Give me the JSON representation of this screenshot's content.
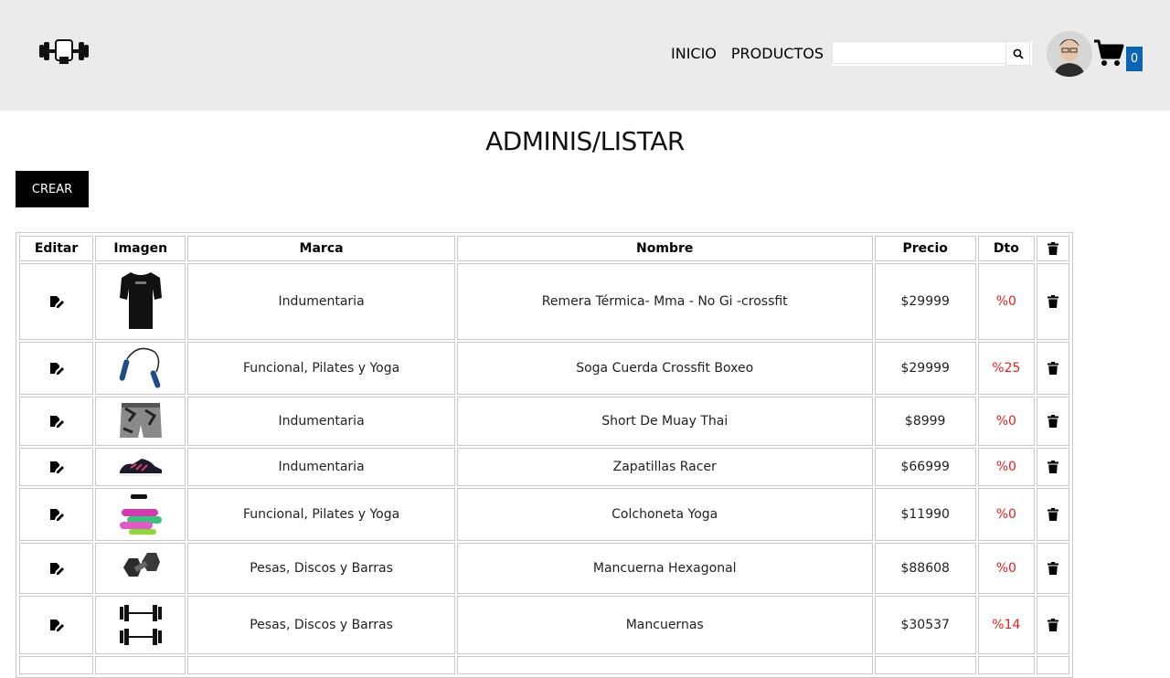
{
  "header": {
    "nav": {
      "inicio": "INICIO",
      "productos": "PRODUCTOS"
    },
    "search": {
      "placeholder": "",
      "value": ""
    },
    "cart_count": "0"
  },
  "main": {
    "title": "ADMINIS/LISTAR",
    "create_label": "CREAR"
  },
  "table": {
    "headers": {
      "editar": "Editar",
      "imagen": "Imagen",
      "marca": "Marca",
      "nombre": "Nombre",
      "precio": "Precio",
      "dto": "Dto"
    },
    "rows": [
      {
        "marca": "Indumentaria",
        "nombre": "Remera Térmica- Mma - No Gi -crossfit",
        "precio": "$29999",
        "dto": "%0",
        "image_icon": "tshirt-image"
      },
      {
        "marca": "Funcional, Pilates y Yoga",
        "nombre": "Soga Cuerda Crossfit Boxeo",
        "precio": "$29999",
        "dto": "%25",
        "image_icon": "jump-rope-image"
      },
      {
        "marca": "Indumentaria",
        "nombre": "Short De Muay Thai",
        "precio": "$8999",
        "dto": "%0",
        "image_icon": "shorts-image"
      },
      {
        "marca": "Indumentaria",
        "nombre": "Zapatillas Racer",
        "precio": "$66999",
        "dto": "%0",
        "image_icon": "sneakers-image"
      },
      {
        "marca": "Funcional, Pilates y Yoga",
        "nombre": "Colchoneta Yoga",
        "precio": "$11990",
        "dto": "%0",
        "image_icon": "yoga-mats-image"
      },
      {
        "marca": "Pesas, Discos y Barras",
        "nombre": "Mancuerna Hexagonal",
        "precio": "$88608",
        "dto": "%0",
        "image_icon": "hex-dumbbell-image"
      },
      {
        "marca": "Pesas, Discos y Barras",
        "nombre": "Mancuernas",
        "precio": "$30537",
        "dto": "%14",
        "image_icon": "dumbbells-image"
      }
    ]
  },
  "colors": {
    "header_bg": "#ebebeb",
    "discount": "#e02020",
    "cart_badge": "#0a66b5"
  }
}
